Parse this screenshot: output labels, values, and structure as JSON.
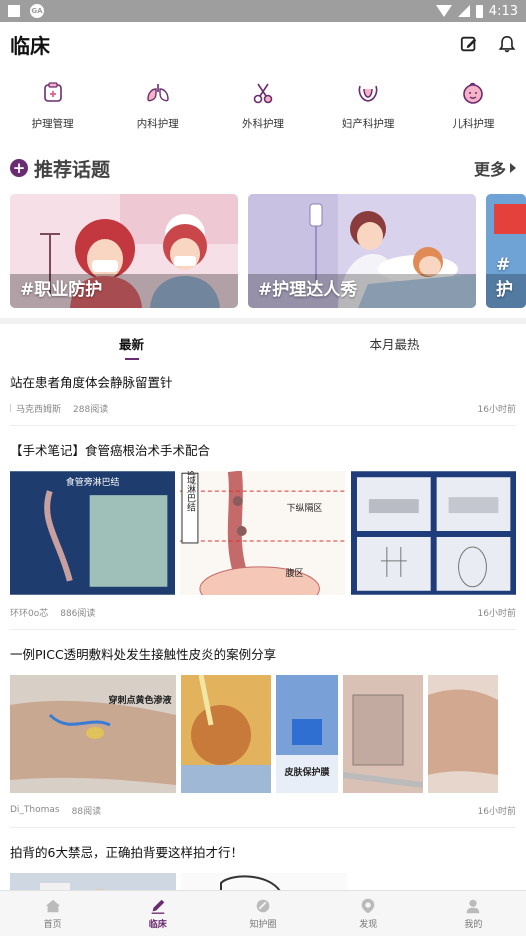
{
  "status_bar": {
    "time": "4:13"
  },
  "header": {
    "title": "临床"
  },
  "categories": [
    {
      "label": "护理管理",
      "icon": "nursing-management-icon"
    },
    {
      "label": "内科护理",
      "icon": "lungs-icon"
    },
    {
      "label": "外科护理",
      "icon": "scissors-icon"
    },
    {
      "label": "妇产科护理",
      "icon": "uterus-icon"
    },
    {
      "label": "儿科护理",
      "icon": "baby-face-icon"
    }
  ],
  "recommended": {
    "title": "推荐话题",
    "more": "更多",
    "topics": [
      {
        "label": "#职业防护"
      },
      {
        "label": "#护理达人秀"
      },
      {
        "label": "#护"
      }
    ]
  },
  "tabs": [
    {
      "label": "最新",
      "active": true
    },
    {
      "label": "本月最热",
      "active": false
    }
  ],
  "posts": [
    {
      "title": "站在患者角度体会静脉留置针",
      "author": "马克西姆斯",
      "reads": "288阅读",
      "time": "16小时前"
    },
    {
      "title": "【手术笔记】食管癌根治术手术配合",
      "author": "环环0o芯",
      "reads": "886阅读",
      "time": "16小时前",
      "image_texts": [
        "食管旁淋巴结",
        "区域淋巴结",
        "下纵隔区",
        "腹区"
      ]
    },
    {
      "title": "一例PICC透明敷料处发生接触性皮炎的案例分享",
      "author": "Di_Thomas",
      "reads": "88阅读",
      "time": "16小时前",
      "image_texts": [
        "穿刺点黄色渗液",
        "皮肤保护膜"
      ]
    },
    {
      "title": "拍背的6大禁忌，正确拍背要这样拍才行！"
    }
  ],
  "bottom_nav": [
    {
      "label": "首页",
      "icon": "home-icon",
      "active": false
    },
    {
      "label": "临床",
      "icon": "pen-icon",
      "active": true
    },
    {
      "label": "知护圈",
      "icon": "circle-icon",
      "active": false
    },
    {
      "label": "发现",
      "icon": "discover-icon",
      "active": false
    },
    {
      "label": "我的",
      "icon": "profile-icon",
      "active": false
    }
  ],
  "colors": {
    "accent": "#6a2c70",
    "status_bar": "#9e9e9e"
  }
}
